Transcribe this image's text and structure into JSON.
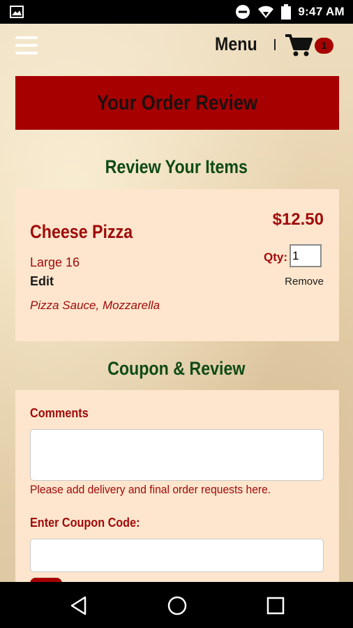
{
  "status_bar": {
    "time": "9:47 AM",
    "icons": [
      "image-icon",
      "do-not-disturb-icon",
      "wifi-icon",
      "battery-icon"
    ]
  },
  "header": {
    "menu_label": "Menu",
    "cart_count": "1",
    "icons": [
      "hamburger-icon",
      "cart-icon"
    ]
  },
  "page": {
    "title": "Your Order Review"
  },
  "review_section": {
    "heading": "Review Your Items",
    "items": [
      {
        "name": "Cheese Pizza",
        "size": "Large 16",
        "edit_label": "Edit",
        "toppings": "Pizza Sauce, Mozzarella",
        "price": "$12.50",
        "qty_label": "Qty:",
        "qty_value": "1",
        "remove_label": "Remove"
      }
    ]
  },
  "coupon_section": {
    "heading": "Coupon & Review",
    "comments_label": "Comments",
    "comments_value": "",
    "comments_hint": "Please add delivery and final order requests here.",
    "coupon_label": "Enter Coupon Code:",
    "coupon_value": ""
  },
  "colors": {
    "brand_red": "#a70000",
    "heading_green": "#0e4a16",
    "card_bg": "#fde6cd"
  },
  "nav_bar": {
    "icons": [
      "back-icon",
      "home-icon",
      "recents-icon"
    ]
  }
}
